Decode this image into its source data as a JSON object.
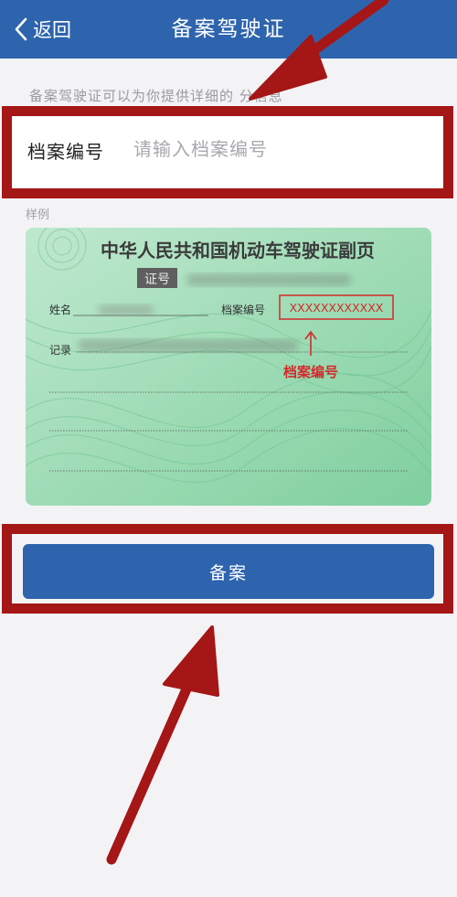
{
  "navbar": {
    "back_label": "返回",
    "title": "备案驾驶证"
  },
  "tip": "备案驾驶证可以为你提供详细的  分信息",
  "form": {
    "label": "档案编号",
    "placeholder": "请输入档案编号",
    "value": ""
  },
  "sample": {
    "label": "样例",
    "card_title": "中华人民共和国机动车驾驶证副页",
    "id_label": "证号",
    "name_label": "姓名",
    "file_no_label": "档案编号",
    "file_no_value": "XXXXXXXXXXXX",
    "record_label": "记录",
    "annotation": "档案编号"
  },
  "submit": {
    "label": "备案"
  },
  "colors": {
    "primary": "#2e64ad",
    "highlight": "#a51616",
    "background": "#f3f3f6"
  }
}
